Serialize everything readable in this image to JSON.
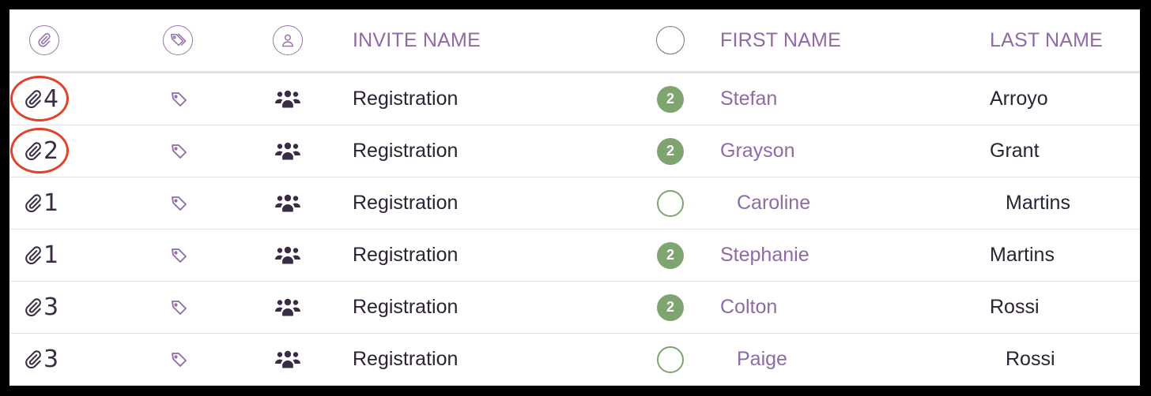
{
  "header": {
    "attachment_icon": "paperclip-icon",
    "tag_icon": "tag-icon",
    "user_icon": "user-icon",
    "invite_name": "INVITE NAME",
    "status_icon": "empty-circle",
    "first_name": "FIRST NAME",
    "last_name": "LAST NAME"
  },
  "colors": {
    "accent_purple": "#8f6aa5",
    "badge_green": "#7ea470",
    "highlight_red": "#e2422c"
  },
  "rows": [
    {
      "attachments": "4",
      "invite": "Registration",
      "badge": "2",
      "first": "Stefan",
      "last": "Arroyo",
      "highlighted": true
    },
    {
      "attachments": "2",
      "invite": "Registration",
      "badge": "2",
      "first": "Grayson",
      "last": "Grant",
      "highlighted": true
    },
    {
      "attachments": "1",
      "invite": "Registration",
      "badge": "",
      "first": "Caroline",
      "last": "Martins",
      "highlighted": false
    },
    {
      "attachments": "1",
      "invite": "Registration",
      "badge": "2",
      "first": "Stephanie",
      "last": "Martins",
      "highlighted": false
    },
    {
      "attachments": "3",
      "invite": "Registration",
      "badge": "2",
      "first": "Colton",
      "last": "Rossi",
      "highlighted": false
    },
    {
      "attachments": "3",
      "invite": "Registration",
      "badge": "",
      "first": "Paige",
      "last": "Rossi",
      "highlighted": false
    }
  ]
}
